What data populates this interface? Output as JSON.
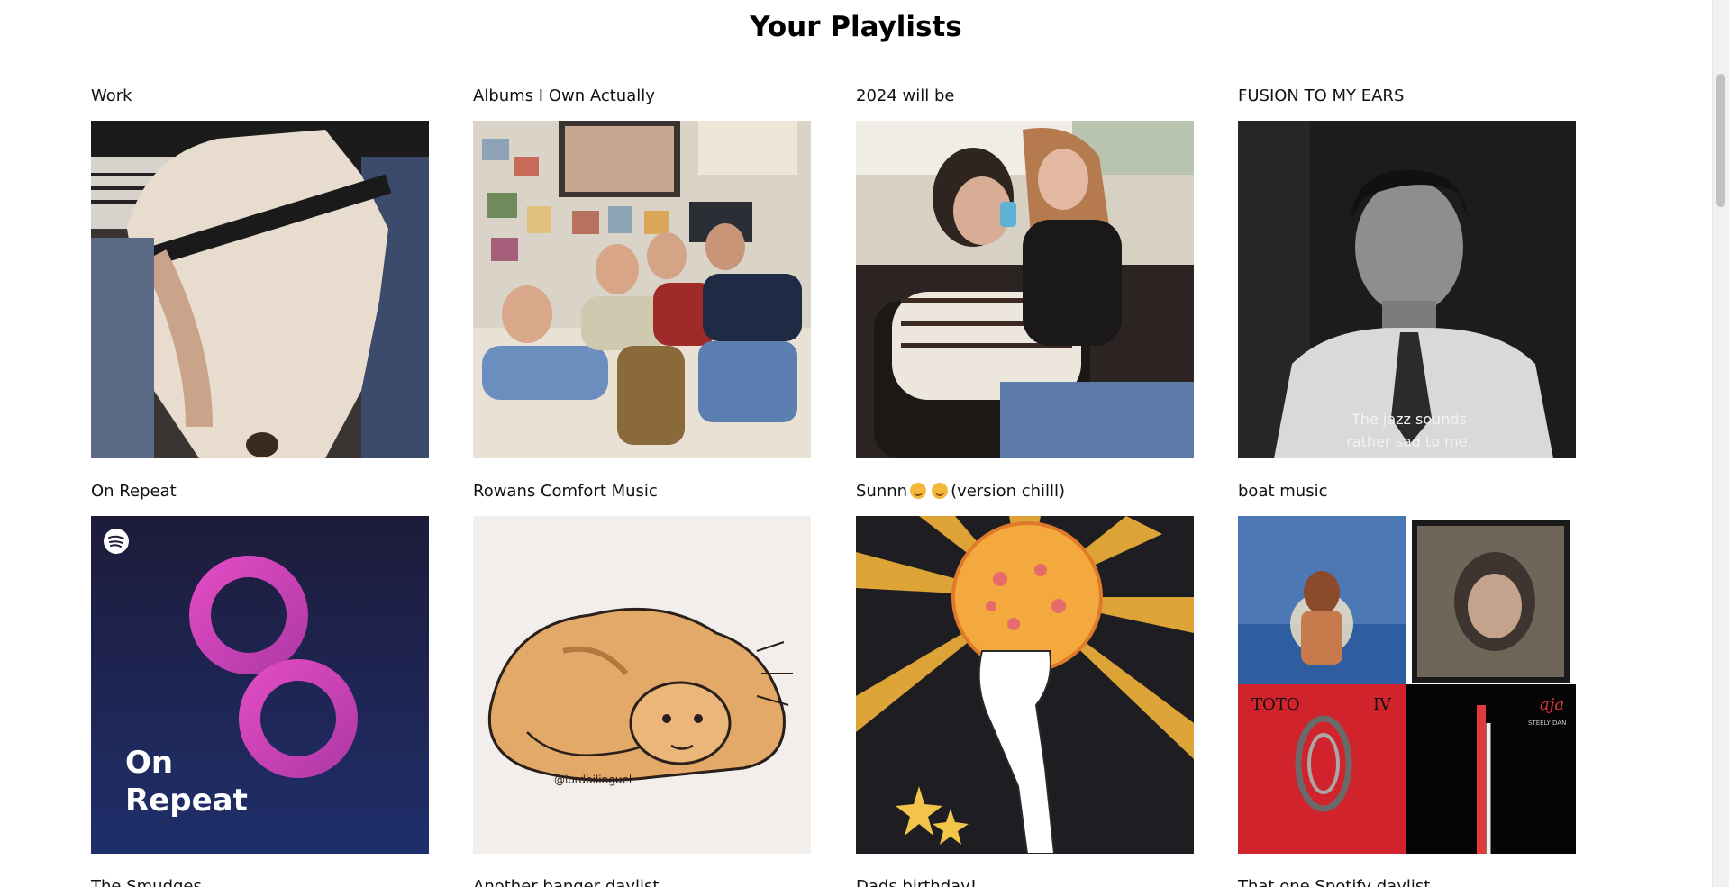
{
  "page": {
    "title": "Your Playlists"
  },
  "playlists": [
    {
      "title": "Work",
      "cover": "photo-cover"
    },
    {
      "title": "Albums I Own Actually",
      "cover": "photo-cover"
    },
    {
      "title": "2024 will be",
      "cover": "photo-cover"
    },
    {
      "title": "FUSION TO MY EARS",
      "cover": "photo-cover",
      "caption_line1": "The jazz sounds",
      "caption_line2": "rather sad to me."
    },
    {
      "title": "On Repeat",
      "cover": "spotify-on-repeat-cover",
      "cover_text_line1": "On",
      "cover_text_line2": "Repeat"
    },
    {
      "title": "Rowans Comfort Music",
      "cover": "illustration-cover",
      "signature": "@lordbilinguel"
    },
    {
      "title_before": "Sunnn",
      "title_after": "(version chilll)",
      "cover": "illustration-cover"
    },
    {
      "title": "boat music",
      "cover": "album-mosaic-cover",
      "album3_text": "TOTO",
      "album3_roman": "IV",
      "album4_text": "aja",
      "album4_sub": "STEELY DAN"
    },
    {
      "title": "The Smudges"
    },
    {
      "title": "Another banger daylist"
    },
    {
      "title": "Dads birthday!"
    },
    {
      "title": "That one Spotify daylist"
    }
  ],
  "colors": {
    "background": "#ffffff",
    "on_repeat_gradient_top": "#1e1b3a",
    "on_repeat_gradient_bottom": "#1f2f6b",
    "on_repeat_accent": "#d23bb5",
    "scrollbar_thumb": "#c1c1c1"
  },
  "icons": {
    "spotify": "spotify-logo-icon"
  }
}
